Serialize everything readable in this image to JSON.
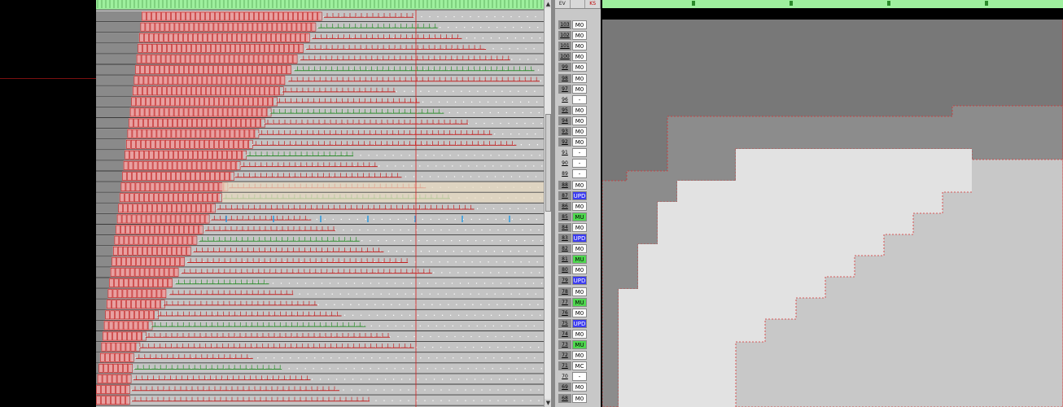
{
  "rows": [
    {
      "num": "103",
      "code": "M0",
      "style": "white",
      "dark": true
    },
    {
      "num": "102",
      "code": "M0",
      "style": "white",
      "dark": true
    },
    {
      "num": "101",
      "code": "M0",
      "style": "white",
      "dark": true
    },
    {
      "num": "100",
      "code": "M0",
      "style": "white",
      "dark": true
    },
    {
      "num": "99",
      "code": "M0",
      "style": "white",
      "dark": true
    },
    {
      "num": "98",
      "code": "M0",
      "style": "white",
      "dark": true
    },
    {
      "num": "97",
      "code": "M0",
      "style": "white",
      "dark": true
    },
    {
      "num": "96",
      "code": "-",
      "style": "white",
      "dark": false
    },
    {
      "num": "95",
      "code": "M0",
      "style": "white",
      "dark": true
    },
    {
      "num": "94",
      "code": "M0",
      "style": "white",
      "dark": true
    },
    {
      "num": "93",
      "code": "M0",
      "style": "white",
      "dark": true
    },
    {
      "num": "92",
      "code": "M0",
      "style": "white",
      "dark": true
    },
    {
      "num": "91",
      "code": "-",
      "style": "white",
      "dark": false
    },
    {
      "num": "90",
      "code": "-",
      "style": "white",
      "dark": false
    },
    {
      "num": "89",
      "code": "-",
      "style": "white",
      "dark": false
    },
    {
      "num": "88",
      "code": "M0",
      "style": "white",
      "dark": true
    },
    {
      "num": "87",
      "code": "UPD",
      "style": "blue",
      "dark": true
    },
    {
      "num": "86",
      "code": "M0",
      "style": "white",
      "dark": true
    },
    {
      "num": "85",
      "code": "MU",
      "style": "green",
      "dark": true
    },
    {
      "num": "84",
      "code": "M0",
      "style": "white",
      "dark": true
    },
    {
      "num": "83",
      "code": "UPD",
      "style": "blue",
      "dark": true
    },
    {
      "num": "82",
      "code": "M0",
      "style": "white",
      "dark": true
    },
    {
      "num": "81",
      "code": "MU",
      "style": "green",
      "dark": true
    },
    {
      "num": "80",
      "code": "M0",
      "style": "white",
      "dark": true
    },
    {
      "num": "79",
      "code": "UPD",
      "style": "blue",
      "dark": true
    },
    {
      "num": "78",
      "code": "M0",
      "style": "white",
      "dark": true
    },
    {
      "num": "77",
      "code": "MU",
      "style": "green",
      "dark": true
    },
    {
      "num": "76",
      "code": "M0",
      "style": "white",
      "dark": true
    },
    {
      "num": "75",
      "code": "UPD",
      "style": "blue",
      "dark": true
    },
    {
      "num": "74",
      "code": "M0",
      "style": "white",
      "dark": true
    },
    {
      "num": "73",
      "code": "MU",
      "style": "green",
      "dark": true
    },
    {
      "num": "72",
      "code": "M0",
      "style": "white",
      "dark": true
    },
    {
      "num": "71",
      "code": "MC",
      "style": "white",
      "dark": true
    },
    {
      "num": "70",
      "code": "-",
      "style": "white",
      "dark": false
    },
    {
      "num": "69",
      "code": "M0",
      "style": "white",
      "dark": true
    },
    {
      "num": "68",
      "code": "M0",
      "style": "white",
      "dark": true
    }
  ],
  "header_tabs": [
    "EV",
    "",
    "KS"
  ],
  "colors": {
    "accent_red": "#d23030",
    "accent_green": "#2a8a2a",
    "accent_blue": "#3b3bf0",
    "timeline_green": "#9ef09e"
  }
}
